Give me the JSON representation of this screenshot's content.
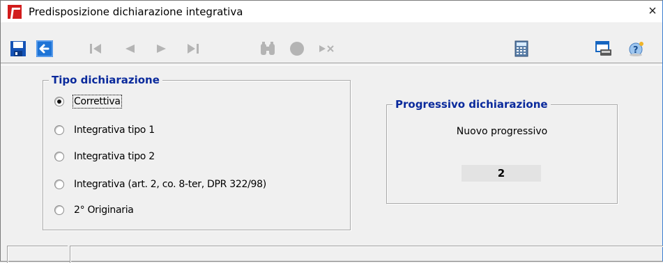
{
  "window": {
    "title": "Predisposizione dichiarazione integrativa",
    "close_glyph": "×"
  },
  "toolbar": {
    "buttons": [
      {
        "name": "save-icon",
        "enabled": true
      },
      {
        "name": "back-arrow-icon",
        "enabled": true
      },
      {
        "name": "first-record-icon",
        "enabled": false
      },
      {
        "name": "previous-record-icon",
        "enabled": false
      },
      {
        "name": "next-record-icon",
        "enabled": false
      },
      {
        "name": "last-record-icon",
        "enabled": false
      },
      {
        "name": "binoculars-icon",
        "enabled": false
      },
      {
        "name": "record-circle-icon",
        "enabled": false
      },
      {
        "name": "delete-record-icon",
        "enabled": false
      },
      {
        "name": "calculator-icon",
        "enabled": true
      },
      {
        "name": "print-preview-icon",
        "enabled": true
      },
      {
        "name": "help-icon",
        "enabled": true
      }
    ]
  },
  "tipo": {
    "legend": "Tipo dichiarazione",
    "options": [
      {
        "label": "Correttiva",
        "checked": true
      },
      {
        "label": "Integrativa tipo 1",
        "checked": false
      },
      {
        "label": "Integrativa tipo 2",
        "checked": false
      },
      {
        "label": "Integrativa (art. 2, co. 8-ter, DPR 322/98)",
        "checked": false
      },
      {
        "label": "2° Originaria",
        "checked": false
      }
    ]
  },
  "progressivo": {
    "legend": "Progressivo dichiarazione",
    "label": "Nuovo progressivo",
    "value": "2"
  },
  "colors": {
    "legend_text": "#0a2a9c",
    "app_icon": "#d21c1c",
    "toolbar_blue": "#1565c0",
    "disabled_gray": "#b4b4b4"
  }
}
